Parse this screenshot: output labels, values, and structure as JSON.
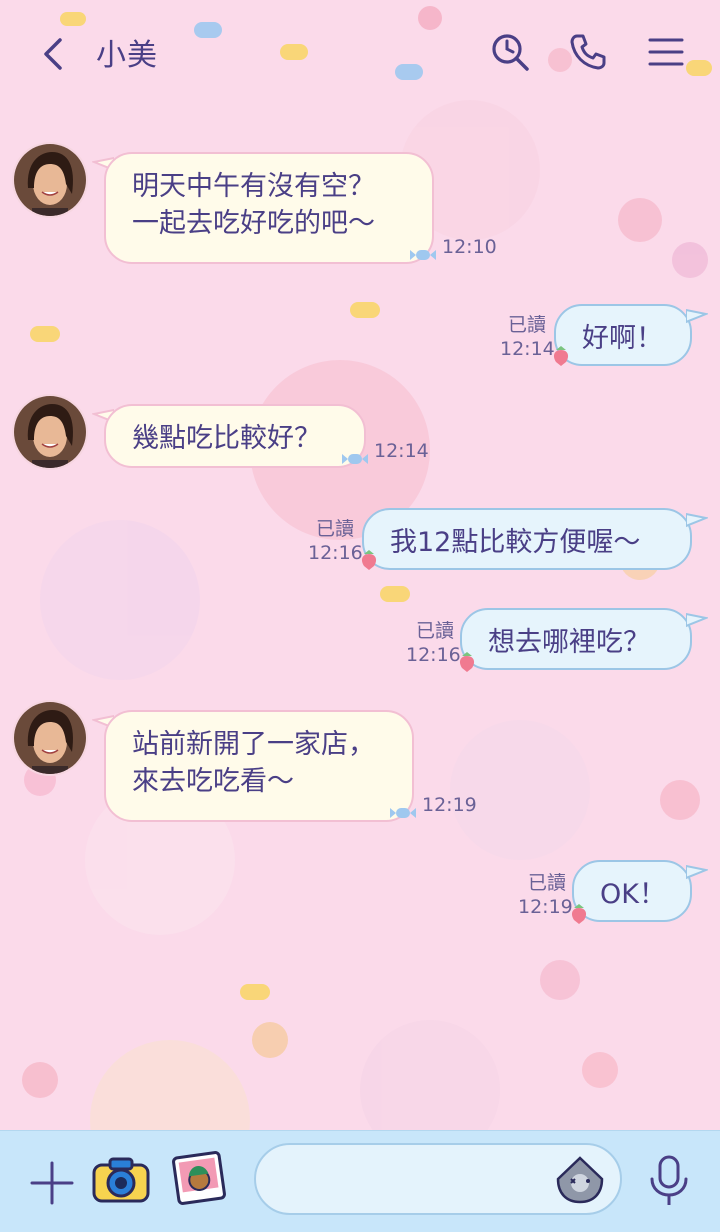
{
  "header": {
    "contact_name": "小美",
    "icons": [
      "back-icon",
      "search-icon",
      "phone-icon",
      "menu-icon"
    ]
  },
  "messages": [
    {
      "side": "in",
      "text": "明天中午有沒有空？\n一起去吃好吃的吧～",
      "time": "12:10"
    },
    {
      "side": "out",
      "text": "好啊！",
      "time": "12:14",
      "read": "已讀"
    },
    {
      "side": "in",
      "text": "幾點吃比較好？",
      "time": "12:14"
    },
    {
      "side": "out",
      "text": "我12點比較方便喔～",
      "time": "12:16",
      "read": "已讀"
    },
    {
      "side": "out",
      "text": "想去哪裡吃？",
      "time": "12:16",
      "read": "已讀"
    },
    {
      "side": "in",
      "text": "站前新開了一家店，\n來去吃吃看～",
      "time": "12:19"
    },
    {
      "side": "out",
      "text": "OK！",
      "time": "12:19",
      "read": "已讀"
    }
  ],
  "footer": {
    "input_value": "",
    "icons": [
      "plus-icon",
      "camera-icon",
      "photo-icon",
      "sticker-icon",
      "microphone-icon"
    ]
  },
  "colors": {
    "background": "#fbdaea",
    "accent": "#4a3f86",
    "incoming_bubble": "#fffbea",
    "outgoing_bubble": "#e6f4fc",
    "footer": "#c8e6fa"
  }
}
